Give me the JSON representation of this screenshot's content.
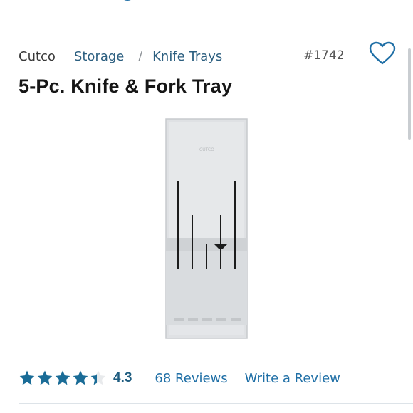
{
  "colors": {
    "accent": "#1f6fa6",
    "star": "#1a6c97",
    "link": "#2c5f80"
  },
  "breadcrumb": {
    "brand": "Cutco",
    "items": [
      {
        "label": "Storage"
      },
      {
        "label": "Knife Trays"
      }
    ],
    "separator": "/"
  },
  "product": {
    "sku": "#1742",
    "title": "5-Pc. Knife & Fork Tray",
    "favorite_icon": "heart-outline-icon",
    "image": {
      "name": "knife-and-fork-tray",
      "description": "Gray knife tray with five slots"
    }
  },
  "rating": {
    "value": "4.3",
    "value_numeric": 4.3,
    "max": 5,
    "reviews_label": "68 Reviews",
    "write_review_label": "Write a Review"
  }
}
